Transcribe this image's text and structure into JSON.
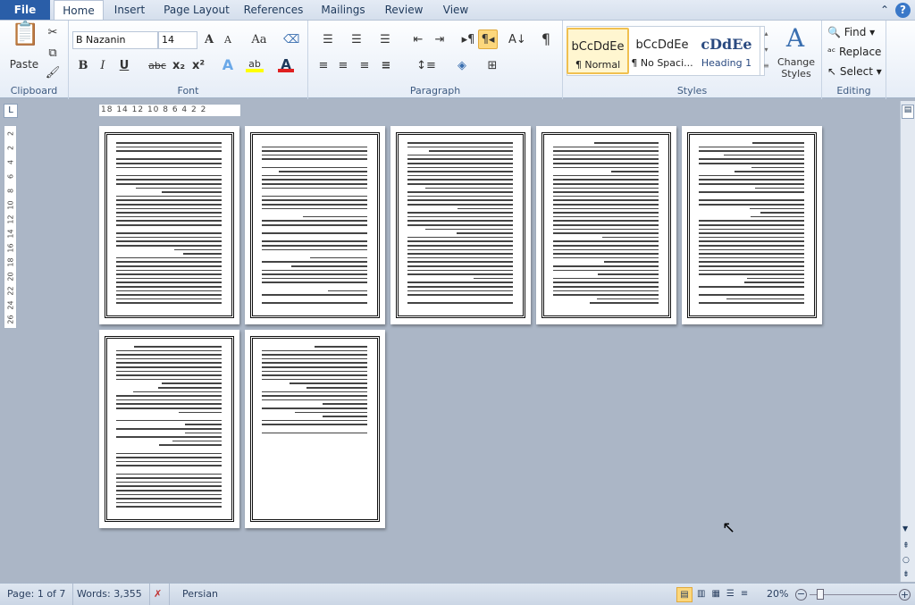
{
  "tabs": {
    "file": "File",
    "items": [
      "Home",
      "Insert",
      "Page Layout",
      "References",
      "Mailings",
      "Review",
      "View"
    ],
    "active": "Home"
  },
  "clipboard": {
    "paste": "Paste",
    "label": "Clipboard"
  },
  "font": {
    "name": "B Nazanin",
    "size": "14",
    "label": "Font",
    "highlight_color": "#ffff00",
    "font_color": "#e02020"
  },
  "paragraph": {
    "label": "Paragraph"
  },
  "styles": {
    "label": "Styles",
    "items": [
      {
        "preview": "bCcDdEe",
        "name": "¶ Normal"
      },
      {
        "preview": "bCcDdEe",
        "name": "¶ No Spaci..."
      },
      {
        "preview": "cDdEe",
        "name": "Heading 1"
      }
    ],
    "change": "Change Styles",
    "selected": "¶ Normal"
  },
  "editing": {
    "label": "Editing",
    "find": "Find",
    "replace": "Replace",
    "select": "Select"
  },
  "ruler": {
    "h": "18  14 12 10  8  6  4  2    2",
    "v": [
      "2",
      "2",
      "4",
      "6",
      "8",
      "10",
      "12",
      "14",
      "16",
      "18",
      "20",
      "22",
      "24",
      "26"
    ]
  },
  "document": {
    "pages": 7
  },
  "status": {
    "page": "Page: 1 of 7",
    "words": "Words: 3,355",
    "language": "Persian",
    "zoom": "20%",
    "zoom_percent": 20
  }
}
